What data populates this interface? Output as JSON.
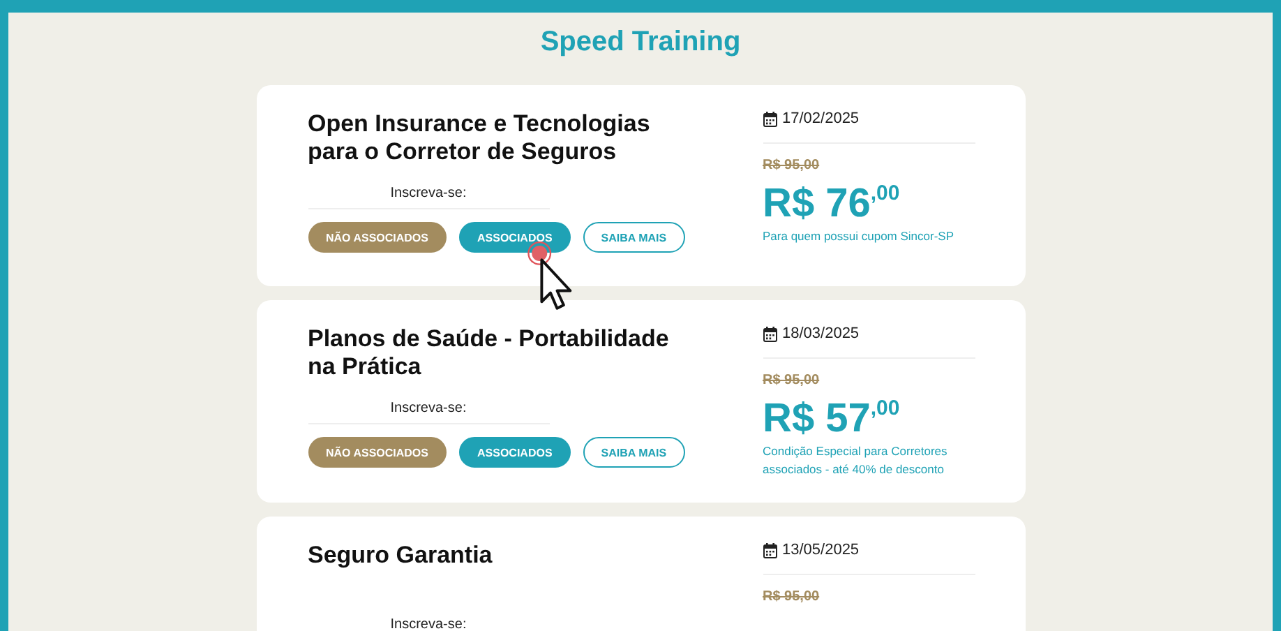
{
  "page": {
    "title": "Speed Training"
  },
  "courses": [
    {
      "title": "Open Insurance e Tecnologias para o Corretor de Seguros",
      "date": "17/02/2025",
      "old_price": "R$ 95,00",
      "price": "R$ 76",
      "cents": ",00",
      "note": "Para quem possui cupom Sincor-SP",
      "signup_label": "Inscreva-se:",
      "buttons": [
        {
          "label": "NÃO ASSOCIADOS",
          "kind": "brown"
        },
        {
          "label": "ASSOCIADOS",
          "kind": "teal"
        },
        {
          "label": "SAIBA MAIS",
          "kind": "outline"
        }
      ]
    },
    {
      "title": "Planos de Saúde - Portabilidade na Prática",
      "date": "18/03/2025",
      "old_price": "R$ 95,00",
      "price": "R$ 57",
      "cents": ",00",
      "note": "Condição Especial para Corretores associados - até 40% de desconto",
      "signup_label": "Inscreva-se:",
      "buttons": [
        {
          "label": "NÃO ASSOCIADOS",
          "kind": "brown"
        },
        {
          "label": "ASSOCIADOS",
          "kind": "teal"
        },
        {
          "label": "SAIBA MAIS",
          "kind": "outline"
        }
      ]
    },
    {
      "title": "Seguro Garantia",
      "date": "13/05/2025",
      "old_price": "R$ 95,00",
      "signup_label": "Inscreva-se:"
    }
  ]
}
